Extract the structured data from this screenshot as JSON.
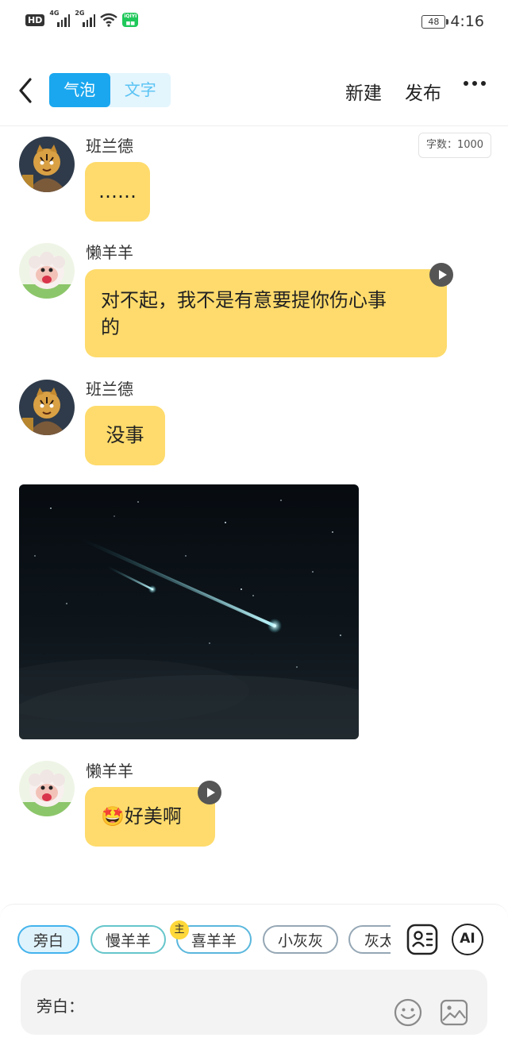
{
  "status_bar": {
    "hd_label": "HD",
    "sim1_network": "4G",
    "sim2_network": "2G",
    "battery_level": "48",
    "time": "4:16"
  },
  "header": {
    "tabs": [
      {
        "label": "气泡",
        "active": true
      },
      {
        "label": "文字",
        "active": false
      }
    ],
    "new_label": "新建",
    "publish_label": "发布",
    "more_icon": "more-dots-icon"
  },
  "word_count": "字数：1000",
  "messages": [
    {
      "speaker": "班兰德",
      "text": "……",
      "has_voice": false
    },
    {
      "speaker": "懒羊羊",
      "text_line1": "对不起，我不是有意要提你伤心事",
      "text_line2": "的",
      "has_voice": true
    },
    {
      "speaker": "班兰德",
      "text": "没事",
      "has_voice": false
    },
    {
      "type": "image",
      "description_icon": "meteor-night-sky-image"
    },
    {
      "speaker": "懒羊羊",
      "emoji": "🤩",
      "text": "好美啊",
      "has_voice": true
    }
  ],
  "characters": [
    {
      "label": "旁白",
      "selected": true
    },
    {
      "label": "慢羊羊",
      "selected": false
    },
    {
      "label": "喜羊羊",
      "selected": false,
      "badge": "主"
    },
    {
      "label": "小灰灰",
      "selected": false
    },
    {
      "label": "灰太",
      "selected": false
    }
  ],
  "input": {
    "placeholder": "旁白："
  },
  "buttons": {
    "ai_label": "AI"
  },
  "colors": {
    "accent": "#1aa7ef",
    "bubble": "#fedb6c",
    "badge": "#ffd83a"
  }
}
